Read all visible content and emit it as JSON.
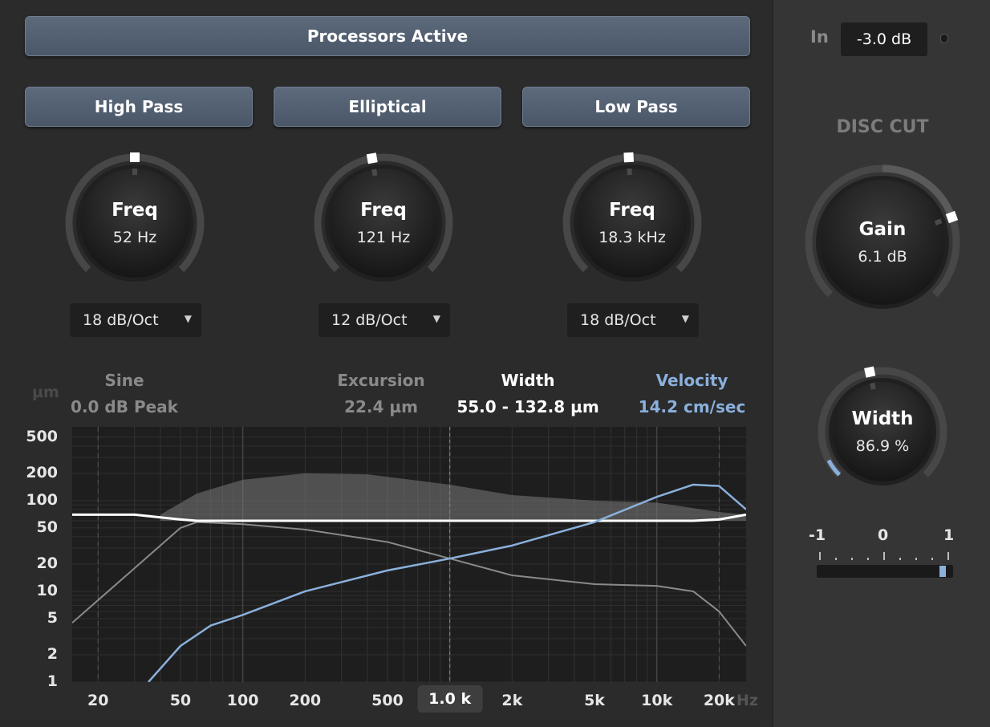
{
  "processors_button": "Processors Active",
  "filters": [
    {
      "label": "High Pass",
      "knob_title": "Freq",
      "knob_value": "52 Hz",
      "slope": "18 dB/Oct"
    },
    {
      "label": "Elliptical",
      "knob_title": "Freq",
      "knob_value": "121 Hz",
      "slope": "12 dB/Oct"
    },
    {
      "label": "Low Pass",
      "knob_title": "Freq",
      "knob_value": "18.3 kHz",
      "slope": "18 dB/Oct"
    }
  ],
  "readouts": {
    "unit": "µm",
    "sine_label": "Sine",
    "sine_value": "0.0 dB Peak",
    "excursion_label": "Excursion",
    "excursion_value": "22.4 µm",
    "width_label": "Width",
    "width_value": "55.0 - 132.8 µm",
    "velocity_label": "Velocity",
    "velocity_value": "14.2 cm/sec"
  },
  "graph": {
    "y_ticks": [
      "500",
      "200",
      "100",
      "50",
      "20",
      "10",
      "5",
      "2",
      "1"
    ],
    "x_ticks": [
      "20",
      "50",
      "100",
      "200",
      "500",
      "1.0 k",
      "2k",
      "5k",
      "10k",
      "20k"
    ],
    "x_unit": "Hz",
    "selected_x_tick": "1.0 k"
  },
  "input": {
    "label": "In",
    "value": "-3.0 dB"
  },
  "disc_cut": {
    "title": "DISC CUT",
    "gain_title": "Gain",
    "gain_value": "6.1 dB",
    "width_title": "Width",
    "width_value": "86.9 %",
    "balance_labels": [
      "-1",
      "0",
      "1"
    ],
    "balance_value": 0.92
  },
  "colors": {
    "accent": "#8ab0dc",
    "button": "#566477",
    "panel": "#2b2b2b"
  },
  "chart_data": {
    "type": "line",
    "xlabel": "Hz",
    "ylabel": "µm",
    "x_scale": "log",
    "y_scale": "log",
    "xlim": [
      15,
      27000
    ],
    "ylim": [
      1,
      650
    ],
    "series": [
      {
        "name": "",
        "x": [
          15,
          20,
          30,
          50,
          60,
          100,
          200,
          500,
          1000,
          2000,
          5000,
          10000,
          15000,
          20000,
          27000
        ],
        "y": [
          70,
          70,
          70,
          62,
          60,
          60,
          60,
          60,
          60,
          60,
          60,
          60,
          60,
          62,
          70
        ]
      },
      {
        "name": "",
        "x": [
          40,
          60,
          100,
          200,
          400,
          1000,
          2000,
          5000,
          10000,
          20000,
          27000
        ],
        "y": [
          70,
          120,
          170,
          200,
          195,
          150,
          115,
          100,
          95,
          75,
          70
        ]
      },
      {
        "name": "",
        "x": [
          15,
          30,
          50,
          60,
          100,
          200,
          500,
          1000,
          2000,
          5000,
          10000,
          15000,
          20000,
          27000
        ],
        "y": [
          4.5,
          18,
          50,
          58,
          55,
          48,
          35,
          23,
          15,
          12,
          11.5,
          10,
          6,
          2.5
        ]
      },
      {
        "name": "Velocity",
        "x": [
          35,
          50,
          70,
          100,
          200,
          500,
          1000,
          2000,
          5000,
          10000,
          15000,
          20000,
          27000
        ],
        "y": [
          1,
          2.5,
          4.2,
          5.5,
          10,
          17,
          23,
          32,
          58,
          110,
          150,
          145,
          80
        ]
      }
    ]
  }
}
